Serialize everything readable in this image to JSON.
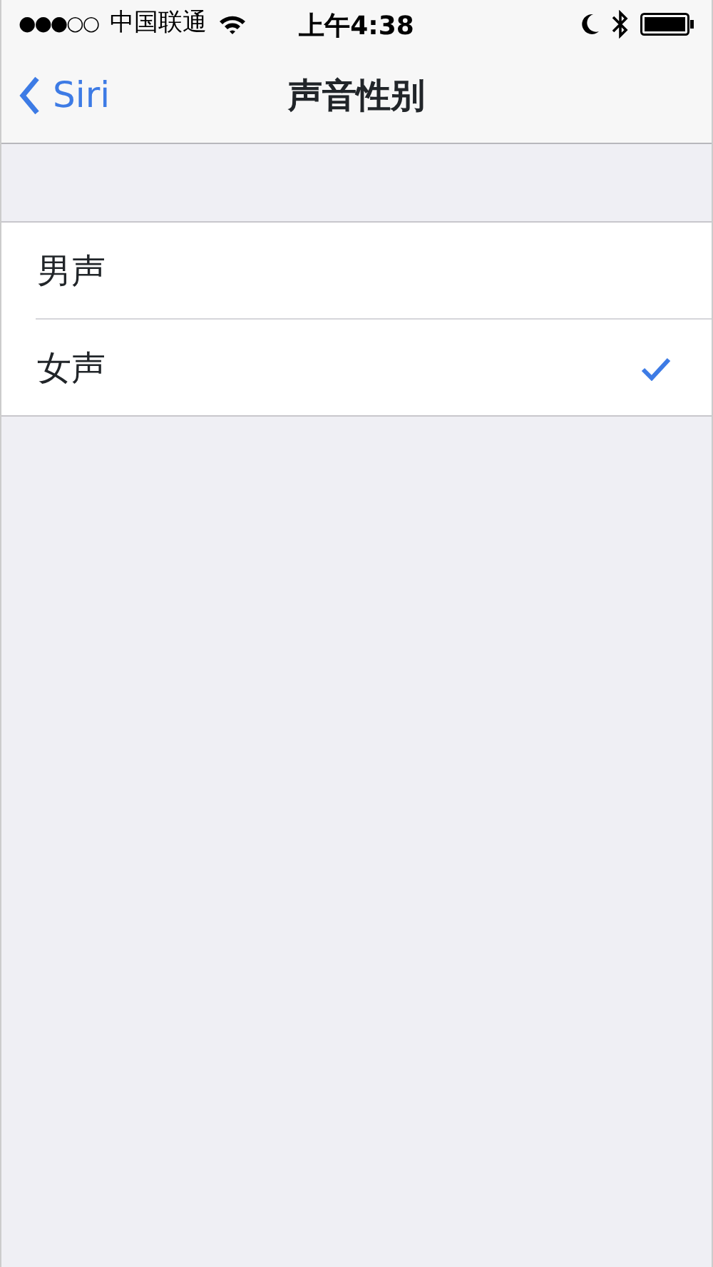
{
  "status_bar": {
    "signal": "●●●○○",
    "carrier": "中国联通",
    "time": "上午4:38"
  },
  "nav_bar": {
    "back_label": "Siri",
    "title": "声音性别"
  },
  "options": [
    {
      "label": "男声",
      "selected": false
    },
    {
      "label": "女声",
      "selected": true
    }
  ]
}
